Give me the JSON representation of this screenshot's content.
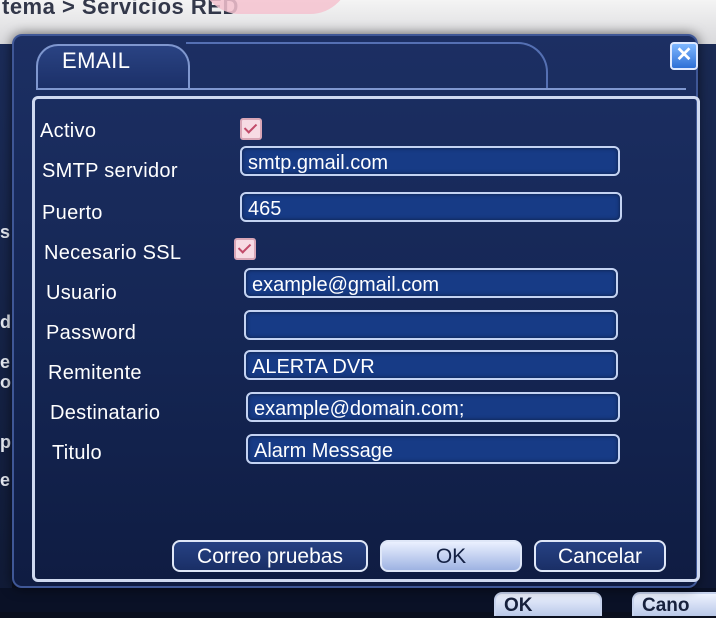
{
  "background": {
    "breadcrumb": "tema > Servicios RED",
    "left_fragments": [
      "s",
      "d",
      "e",
      "o",
      "p",
      "e"
    ],
    "bottom_buttons": [
      "OK",
      "Cano"
    ]
  },
  "dialog": {
    "title": "EMAIL",
    "close_symbol": "✕",
    "fields": {
      "activo": {
        "label": "Activo",
        "checked": true
      },
      "smtp": {
        "label": "SMTP servidor",
        "value": "smtp.gmail.com"
      },
      "puerto": {
        "label": "Puerto",
        "value": "465"
      },
      "ssl": {
        "label": "Necesario SSL",
        "checked": true
      },
      "usuario": {
        "label": "Usuario",
        "value": "example@gmail.com"
      },
      "password": {
        "label": "Password",
        "value": ""
      },
      "remitente": {
        "label": "Remitente",
        "value": "ALERTA DVR"
      },
      "destinatario": {
        "label": "Destinatario",
        "value": "example@domain.com;"
      },
      "titulo": {
        "label": "Titulo",
        "value": "Alarm Message"
      }
    },
    "buttons": {
      "test": "Correo pruebas",
      "ok": "OK",
      "cancel": "Cancelar"
    }
  },
  "colors": {
    "dialog_bg": "#1c2f63",
    "field_bg": "#173b86",
    "checkbox": "#f7dbe4",
    "ok_button": "#eaf0ff"
  }
}
